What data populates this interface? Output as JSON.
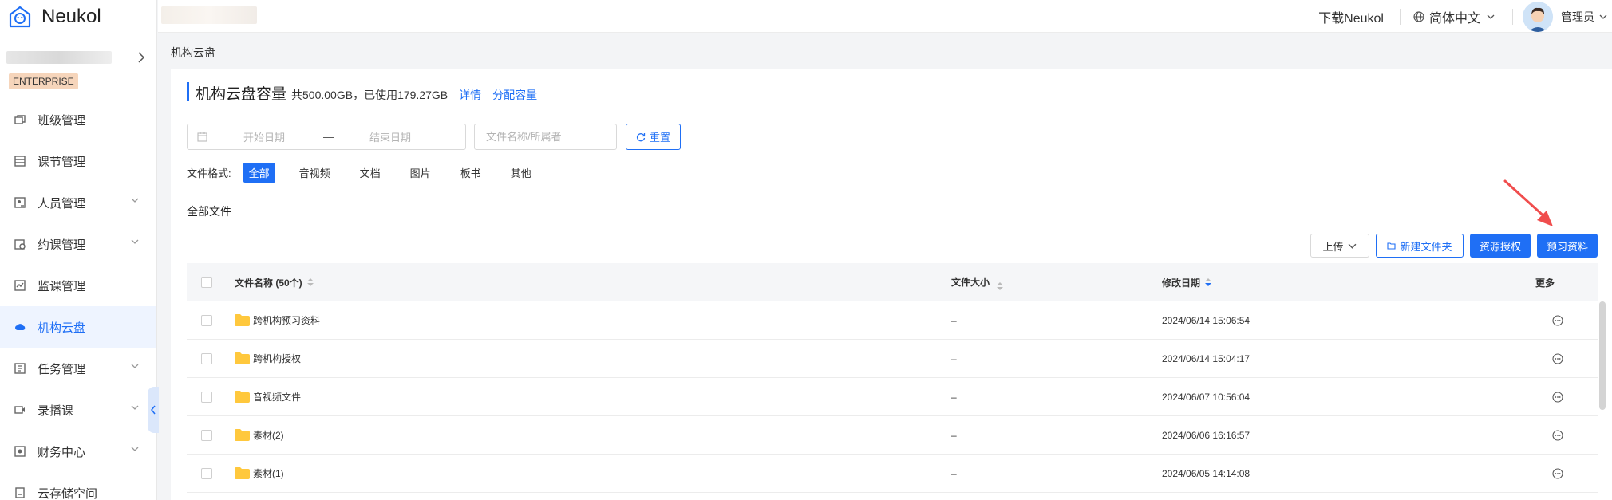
{
  "brand": {
    "name": "Neukol",
    "badge": "ENTERPRISE"
  },
  "topbar": {
    "download": "下载Neukol",
    "language": "简体中文",
    "user": "管理员"
  },
  "sidebar": {
    "items": [
      {
        "label": "班级管理",
        "icon": "class-icon",
        "has_chevron": false
      },
      {
        "label": "课节管理",
        "icon": "lesson-icon",
        "has_chevron": false
      },
      {
        "label": "人员管理",
        "icon": "people-icon",
        "has_chevron": true
      },
      {
        "label": "约课管理",
        "icon": "booking-icon",
        "has_chevron": true
      },
      {
        "label": "监课管理",
        "icon": "monitor-icon",
        "has_chevron": false
      },
      {
        "label": "机构云盘",
        "icon": "cloud-icon",
        "has_chevron": false,
        "active": true
      },
      {
        "label": "任务管理",
        "icon": "task-icon",
        "has_chevron": true
      },
      {
        "label": "录播课",
        "icon": "record-icon",
        "has_chevron": true
      },
      {
        "label": "财务中心",
        "icon": "finance-icon",
        "has_chevron": true
      },
      {
        "label": "云存储空间",
        "icon": "storage-icon",
        "has_chevron": false
      }
    ]
  },
  "breadcrumb": "机构云盘",
  "capacity": {
    "title": "机构云盘容量",
    "info": "共500.00GB，已使用179.27GB",
    "detail_link": "详情",
    "allocate_link": "分配容量"
  },
  "filters": {
    "start_placeholder": "开始日期",
    "end_placeholder": "结束日期",
    "range_separator": "—",
    "search_placeholder": "文件名称/所属者",
    "reset": "重置"
  },
  "formats": {
    "label": "文件格式:",
    "items": [
      "全部",
      "音视频",
      "文档",
      "图片",
      "板书",
      "其他"
    ],
    "active": "全部"
  },
  "section_title": "全部文件",
  "actions": {
    "upload": "上传",
    "new_folder": "新建文件夹",
    "authorize": "资源授权",
    "preview_material": "预习资料"
  },
  "table": {
    "headers": {
      "name": "文件名称 (50个)",
      "size": "文件大小",
      "date": "修改日期",
      "more": "更多"
    },
    "rows": [
      {
        "name": "跨机构预习资料",
        "size": "–",
        "date": "2024/06/14 15:06:54"
      },
      {
        "name": "跨机构授权",
        "size": "–",
        "date": "2024/06/14 15:04:17"
      },
      {
        "name": "音视频文件",
        "size": "–",
        "date": "2024/06/07 10:56:04"
      },
      {
        "name": "素材(2)",
        "size": "–",
        "date": "2024/06/06 16:16:57"
      },
      {
        "name": "素材(1)",
        "size": "–",
        "date": "2024/06/05 14:14:08"
      }
    ]
  },
  "colors": {
    "accent": "#1f6ff5",
    "arrow": "#f04d4d",
    "badge": "#f6d5bb",
    "folder": "#ffc83d"
  }
}
